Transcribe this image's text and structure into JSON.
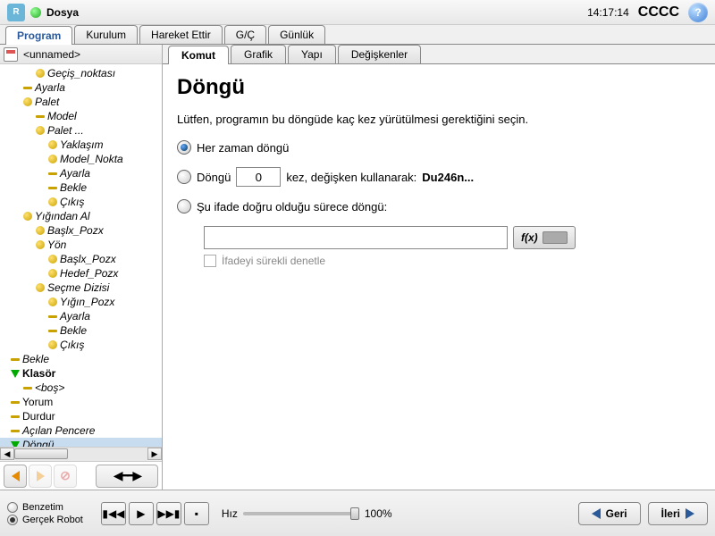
{
  "topbar": {
    "title": "Dosya",
    "time": "14:17:14",
    "cccc": "CCCC",
    "help": "?",
    "logo": "R"
  },
  "main_tabs": [
    "Program",
    "Kurulum",
    "Hareket Ettir",
    "G/Ç",
    "Günlük"
  ],
  "main_tab_active": 0,
  "file_name": "<unnamed>",
  "tree": [
    {
      "indent": 2,
      "bullet": "b-yellow",
      "label": "Geçiş_noktası",
      "italic": true
    },
    {
      "indent": 1,
      "bullet": "b-dash",
      "label": "Ayarla",
      "italic": true
    },
    {
      "indent": 1,
      "bullet": "b-yellow",
      "label": "Palet",
      "italic": true
    },
    {
      "indent": 2,
      "bullet": "b-dash",
      "label": "Model",
      "italic": true
    },
    {
      "indent": 2,
      "bullet": "b-yellow",
      "label": "Palet ...",
      "italic": true
    },
    {
      "indent": 3,
      "bullet": "b-yellow",
      "label": "Yaklaşım",
      "italic": true
    },
    {
      "indent": 3,
      "bullet": "b-yellow",
      "label": "Model_Nokta",
      "italic": true
    },
    {
      "indent": 3,
      "bullet": "b-dash",
      "label": "Ayarla",
      "italic": true
    },
    {
      "indent": 3,
      "bullet": "b-dash",
      "label": "Bekle",
      "italic": true
    },
    {
      "indent": 3,
      "bullet": "b-yellow",
      "label": "Çıkış",
      "italic": true
    },
    {
      "indent": 1,
      "bullet": "b-yellow",
      "label": "Yığından Al",
      "italic": true
    },
    {
      "indent": 2,
      "bullet": "b-yellow",
      "label": "Başlx_Pozx",
      "italic": true
    },
    {
      "indent": 2,
      "bullet": "b-yellow",
      "label": "Yön",
      "italic": true
    },
    {
      "indent": 3,
      "bullet": "b-yellow",
      "label": "Başlx_Pozx",
      "italic": true
    },
    {
      "indent": 3,
      "bullet": "b-yellow",
      "label": "Hedef_Pozx",
      "italic": true
    },
    {
      "indent": 2,
      "bullet": "b-yellow",
      "label": "Seçme Dizisi",
      "italic": true
    },
    {
      "indent": 3,
      "bullet": "b-yellow",
      "label": "Yığın_Pozx",
      "italic": true
    },
    {
      "indent": 3,
      "bullet": "b-dash",
      "label": "Ayarla",
      "italic": true
    },
    {
      "indent": 3,
      "bullet": "b-dash",
      "label": "Bekle",
      "italic": true
    },
    {
      "indent": 3,
      "bullet": "b-yellow",
      "label": "Çıkış",
      "italic": true
    },
    {
      "indent": 0,
      "bullet": "b-dash",
      "label": "Bekle",
      "italic": true
    },
    {
      "indent": 0,
      "bullet": "b-green",
      "label": "Klasör",
      "bold": true
    },
    {
      "indent": 1,
      "bullet": "b-dash",
      "label": "<boş>",
      "italic": true
    },
    {
      "indent": 0,
      "bullet": "b-dash",
      "label": "Yorum",
      "italic": false
    },
    {
      "indent": 0,
      "bullet": "b-dash",
      "label": "Durdur",
      "italic": false
    },
    {
      "indent": 0,
      "bullet": "b-dash",
      "label": "Açılan Pencere",
      "italic": true
    },
    {
      "indent": 0,
      "bullet": "b-green",
      "label": "Döngü",
      "italic": true,
      "selected": true
    }
  ],
  "sub_tabs": [
    "Komut",
    "Grafik",
    "Yapı",
    "Değişkenler"
  ],
  "sub_tab_active": 0,
  "panel": {
    "title": "Döngü",
    "desc": "Lütfen, programın bu döngüde kaç kez yürütülmesi gerektiğini seçin.",
    "opt1": "Her zaman döngü",
    "opt2_pre": "Döngü",
    "opt2_count": "0",
    "opt2_mid": "kez, değişken kullanarak:",
    "opt2_var": "Du246n...",
    "opt3": "Şu ifade doğru olduğu sürece döngü:",
    "fx": "f(x)",
    "chk": "İfadeyi sürekli denetle"
  },
  "bottom": {
    "sim": "Benzetim",
    "real": "Gerçek Robot",
    "speed_label": "Hız",
    "speed_val": "100%",
    "back": "Geri",
    "next": "İleri"
  }
}
